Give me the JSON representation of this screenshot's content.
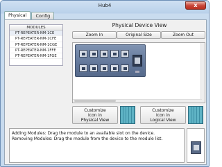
{
  "window": {
    "title": "Hub4",
    "close_label": "x"
  },
  "tabs": [
    {
      "label": "Physical",
      "active": true
    },
    {
      "label": "Config",
      "active": false
    }
  ],
  "modules": {
    "header": "MODULES",
    "items": [
      "PT-REPEATER-NM-1CE",
      "PT-REPEATER-NM-1CFE",
      "PT-REPEATER-NM-1CGE",
      "PT-REPEATER-NM-1FFE",
      "PT-REPEATER-NM-1FGE"
    ]
  },
  "device_view": {
    "title": "Physical Device View",
    "zoom_in": "Zoom In",
    "original_size": "Original Size",
    "zoom_out": "Zoom Out"
  },
  "customize": {
    "physical_label": "Customize\nIcon in\nPhysical View",
    "logical_label": "Customize\nIcon in\nLogical View"
  },
  "info": {
    "line1": "Adding Modules: Drag the module to an available slot on the device.",
    "line2": "Removing Modules: Drag the module from the device to the module list."
  },
  "colors": {
    "accent": "#5fb3c5",
    "device": "#62779a"
  }
}
